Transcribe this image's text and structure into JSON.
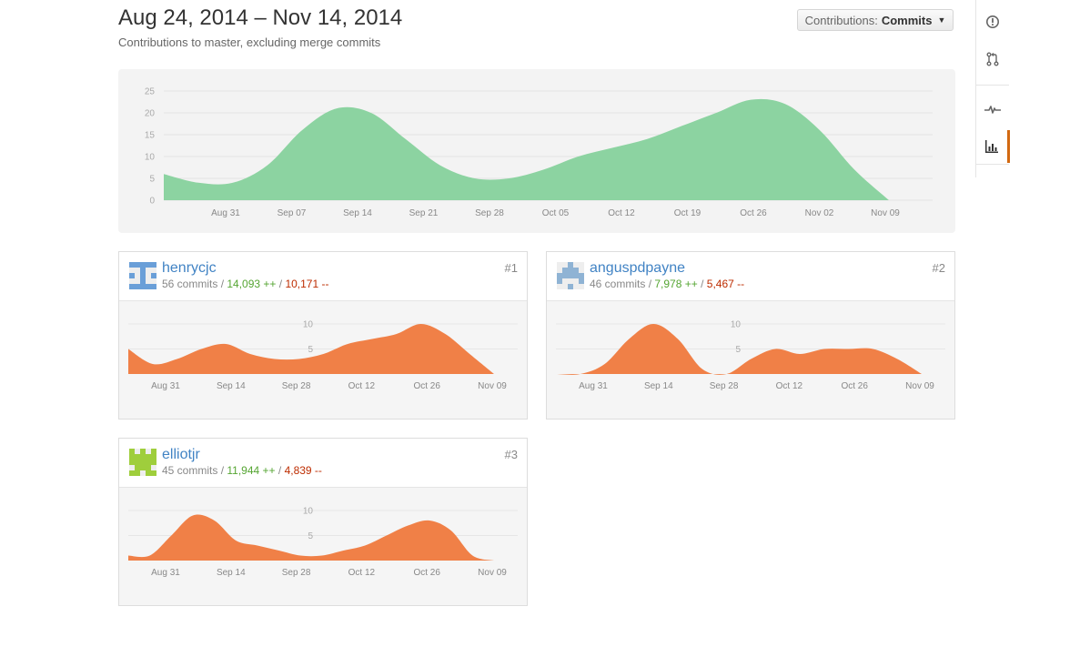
{
  "header": {
    "date_range": "Aug 24, 2014 – Nov 14, 2014",
    "subtitle": "Contributions to master, excluding merge commits"
  },
  "contributions_dropdown": {
    "label": "Contributions:",
    "value": "Commits"
  },
  "side_nav": {
    "items": [
      {
        "icon": "issue-opened-icon",
        "selected": false
      },
      {
        "icon": "git-pull-request-icon",
        "selected": false
      },
      {
        "icon": "pulse-icon",
        "selected": false
      },
      {
        "icon": "graph-icon",
        "selected": true
      }
    ]
  },
  "chart_data": [
    {
      "type": "area",
      "series": [
        {
          "values": [
            6,
            4,
            4,
            8,
            16,
            21,
            20,
            14,
            8,
            5,
            5,
            7,
            10,
            12,
            14,
            17,
            20,
            23,
            22,
            16,
            7,
            0
          ]
        }
      ],
      "x": [
        "Aug 24",
        "Aug 27",
        "Aug 31",
        "Sep 03",
        "Sep 07",
        "Sep 11",
        "Sep 14",
        "Sep 18",
        "Sep 21",
        "Sep 24",
        "Sep 28",
        "Oct 01",
        "Oct 05",
        "Oct 08",
        "Oct 12",
        "Oct 19",
        "Oct 22",
        "Oct 26",
        "Oct 29",
        "Nov 02",
        "Nov 06",
        "Nov 09"
      ],
      "xticks": [
        "Aug 31",
        "Sep 07",
        "Sep 14",
        "Sep 21",
        "Sep 28",
        "Oct 05",
        "Oct 12",
        "Oct 19",
        "Oct 26",
        "Nov 02",
        "Nov 09"
      ],
      "yticks": [
        0,
        5,
        10,
        15,
        20,
        25
      ],
      "ylim": [
        0,
        25
      ],
      "color": "#8cd3a1",
      "grid": true
    },
    {
      "type": "area",
      "series": [
        {
          "values": [
            5,
            2,
            3,
            5,
            6,
            4,
            3,
            3,
            4,
            6,
            7,
            8,
            10,
            8,
            4,
            0
          ]
        }
      ],
      "xticks": [
        "Aug 31",
        "Sep 14",
        "Sep 28",
        "Oct 12",
        "Oct 26",
        "Nov 09"
      ],
      "yticks": [
        5,
        10
      ],
      "ylim": [
        0,
        10
      ],
      "color": "#f08047"
    },
    {
      "type": "area",
      "series": [
        {
          "values": [
            0,
            0,
            2,
            7,
            10,
            7,
            1,
            0,
            3,
            5,
            4,
            5,
            5,
            5,
            3,
            0
          ]
        }
      ],
      "xticks": [
        "Aug 31",
        "Sep 14",
        "Sep 28",
        "Oct 12",
        "Oct 26",
        "Nov 09"
      ],
      "yticks": [
        5,
        10
      ],
      "ylim": [
        0,
        10
      ],
      "color": "#f08047"
    },
    {
      "type": "area",
      "series": [
        {
          "values": [
            1,
            1,
            5,
            9,
            8,
            4,
            3,
            2,
            1,
            1,
            2,
            3,
            5,
            7,
            8,
            6,
            1,
            0
          ]
        }
      ],
      "xticks": [
        "Aug 31",
        "Sep 14",
        "Sep 28",
        "Oct 12",
        "Oct 26",
        "Nov 09"
      ],
      "yticks": [
        5,
        10
      ],
      "ylim": [
        0,
        10
      ],
      "color": "#f08047"
    }
  ],
  "contributors": [
    {
      "username": "henrycjc",
      "rank": "#1",
      "commits": "56 commits",
      "additions": "14,093 ++",
      "deletions": "10,171 --",
      "avatar_color": "#6a9fd8"
    },
    {
      "username": "anguspdpayne",
      "rank": "#2",
      "commits": "46 commits",
      "additions": "7,978 ++",
      "deletions": "5,467 --",
      "avatar_color": "#8fb3d4"
    },
    {
      "username": "elliotjr",
      "rank": "#3",
      "commits": "45 commits",
      "additions": "11,944 ++",
      "deletions": "4,839 --",
      "avatar_color": "#9fce3c"
    }
  ]
}
